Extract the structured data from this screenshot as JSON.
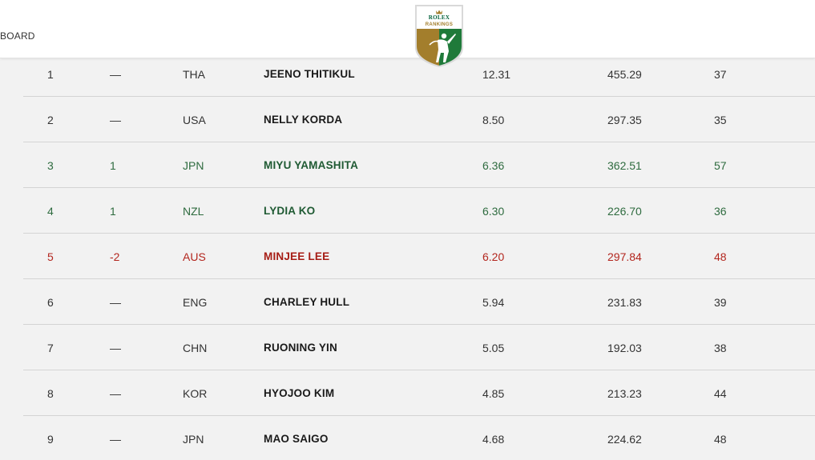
{
  "header": {
    "nav_text": "BOARD",
    "logo": {
      "brand": "ROLEX",
      "sub": "RANKINGS",
      "icon": "golfer-shield-icon",
      "colors": {
        "green": "#006039",
        "gold": "#a37e2c"
      }
    }
  },
  "colors": {
    "up": "#2e6b3f",
    "down": "#b3261e",
    "neutral": "#333333"
  },
  "rankings": [
    {
      "rank": "1",
      "move": "—",
      "country": "THA",
      "name": "JEENO THITIKUL",
      "avg": "12.31",
      "total": "455.29",
      "events": "37",
      "trend": "neutral"
    },
    {
      "rank": "2",
      "move": "—",
      "country": "USA",
      "name": "NELLY KORDA",
      "avg": "8.50",
      "total": "297.35",
      "events": "35",
      "trend": "neutral"
    },
    {
      "rank": "3",
      "move": "1",
      "country": "JPN",
      "name": "MIYU YAMASHITA",
      "avg": "6.36",
      "total": "362.51",
      "events": "57",
      "trend": "up"
    },
    {
      "rank": "4",
      "move": "1",
      "country": "NZL",
      "name": "LYDIA KO",
      "avg": "6.30",
      "total": "226.70",
      "events": "36",
      "trend": "up"
    },
    {
      "rank": "5",
      "move": "-2",
      "country": "AUS",
      "name": "MINJEE LEE",
      "avg": "6.20",
      "total": "297.84",
      "events": "48",
      "trend": "down"
    },
    {
      "rank": "6",
      "move": "—",
      "country": "ENG",
      "name": "CHARLEY HULL",
      "avg": "5.94",
      "total": "231.83",
      "events": "39",
      "trend": "neutral"
    },
    {
      "rank": "7",
      "move": "—",
      "country": "CHN",
      "name": "RUONING YIN",
      "avg": "5.05",
      "total": "192.03",
      "events": "38",
      "trend": "neutral"
    },
    {
      "rank": "8",
      "move": "—",
      "country": "KOR",
      "name": "HYOJOO KIM",
      "avg": "4.85",
      "total": "213.23",
      "events": "44",
      "trend": "neutral"
    },
    {
      "rank": "9",
      "move": "—",
      "country": "JPN",
      "name": "MAO SAIGO",
      "avg": "4.68",
      "total": "224.62",
      "events": "48",
      "trend": "neutral"
    }
  ]
}
